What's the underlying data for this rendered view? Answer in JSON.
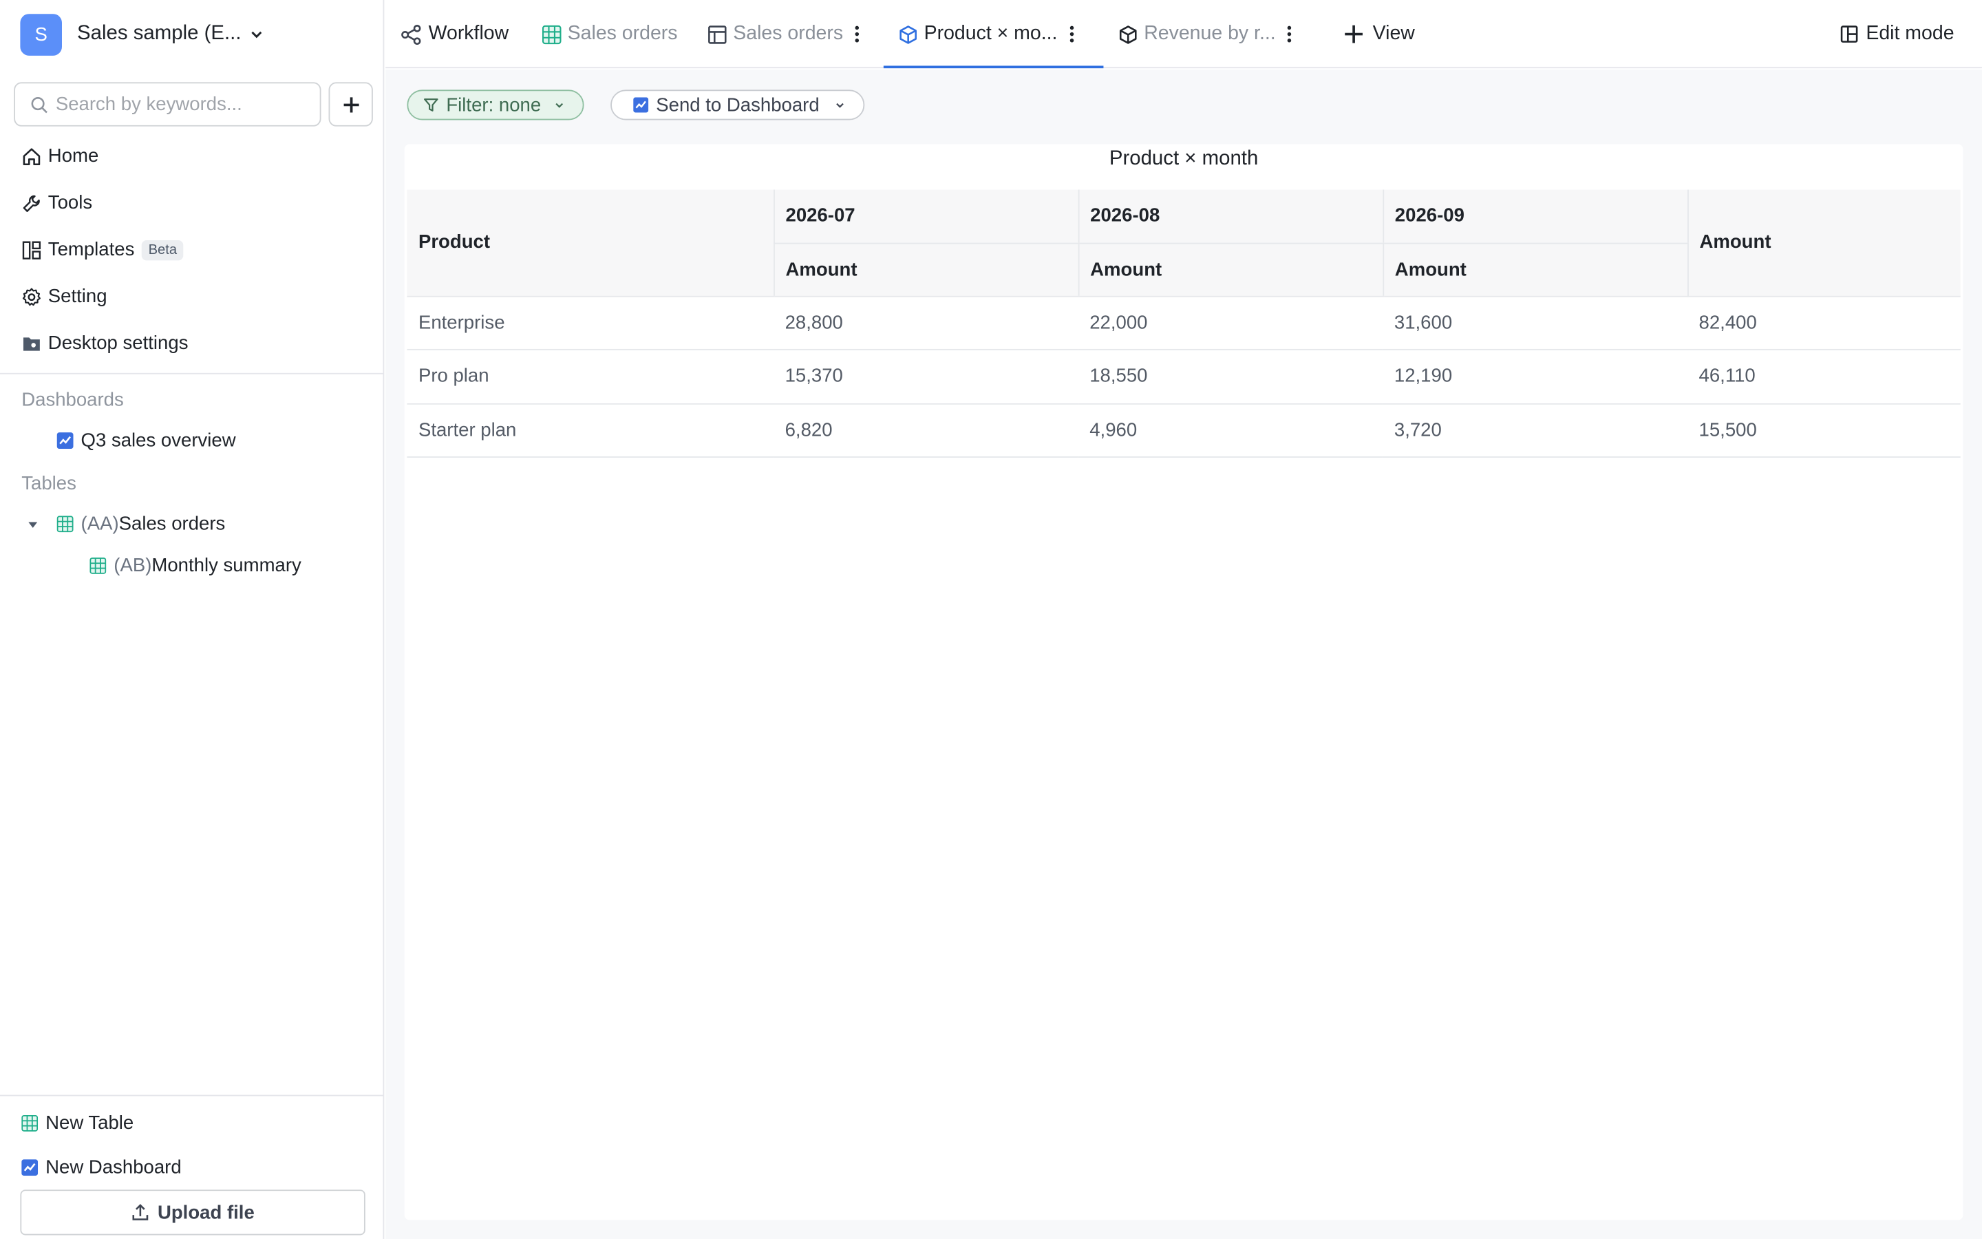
{
  "workspace": {
    "avatar_letter": "S",
    "name": "Sales sample (E..."
  },
  "search": {
    "placeholder": "Search by keywords..."
  },
  "nav": [
    {
      "label": "Home",
      "icon": "home-icon"
    },
    {
      "label": "Tools",
      "icon": "wrench-icon"
    },
    {
      "label": "Templates",
      "icon": "template-icon",
      "badge": "Beta"
    },
    {
      "label": "Setting",
      "icon": "gear-icon"
    },
    {
      "label": "Desktop settings",
      "icon": "desktop-settings-icon"
    }
  ],
  "sections": {
    "dashboards": {
      "title": "Dashboards",
      "items": [
        {
          "label": "Q3 sales overview",
          "icon": "dashboard-icon"
        }
      ]
    },
    "tables": {
      "title": "Tables",
      "items": [
        {
          "code": "(AA)",
          "label": "Sales orders",
          "icon": "table-icon",
          "expanded": true
        },
        {
          "code": "(AB)",
          "label": "Monthly summary",
          "icon": "table-icon"
        }
      ]
    }
  },
  "bottom": {
    "new_table": "New Table",
    "new_dashboard": "New Dashboard",
    "upload": "Upload file"
  },
  "tabs": [
    {
      "label": "Workflow",
      "icon": "workflow-icon",
      "active": false
    },
    {
      "label": "Sales orders",
      "icon": "table-green-icon",
      "active": false
    },
    {
      "label": "Sales orders",
      "icon": "grid-icon",
      "active": false,
      "menu": true
    },
    {
      "label": "Product × mo...",
      "icon": "cube-icon",
      "active": true,
      "menu": true
    },
    {
      "label": "Revenue by r...",
      "icon": "cube-icon",
      "active": false,
      "menu": true
    }
  ],
  "add_view": "View",
  "edit_mode": "Edit mode",
  "toolbar": {
    "filter": "Filter: none",
    "send": "Send to Dashboard"
  },
  "colors": {
    "accent": "#2f6fe0",
    "avatar": "#5b8ff9",
    "filter_chip_bg": "#e7f4ec",
    "table_icon": "#1fae8a"
  },
  "pivot": {
    "title": "Product × month",
    "row_header": "Product",
    "months": [
      "2026-07",
      "2026-08",
      "2026-09"
    ],
    "measure": "Amount",
    "total_header": "Amount",
    "rows": [
      {
        "product": "Enterprise",
        "values": [
          "28,800",
          "22,000",
          "31,600"
        ],
        "total": "82,400"
      },
      {
        "product": "Pro plan",
        "values": [
          "15,370",
          "18,550",
          "12,190"
        ],
        "total": "46,110"
      },
      {
        "product": "Starter plan",
        "values": [
          "6,820",
          "4,960",
          "3,720"
        ],
        "total": "15,500"
      }
    ]
  }
}
